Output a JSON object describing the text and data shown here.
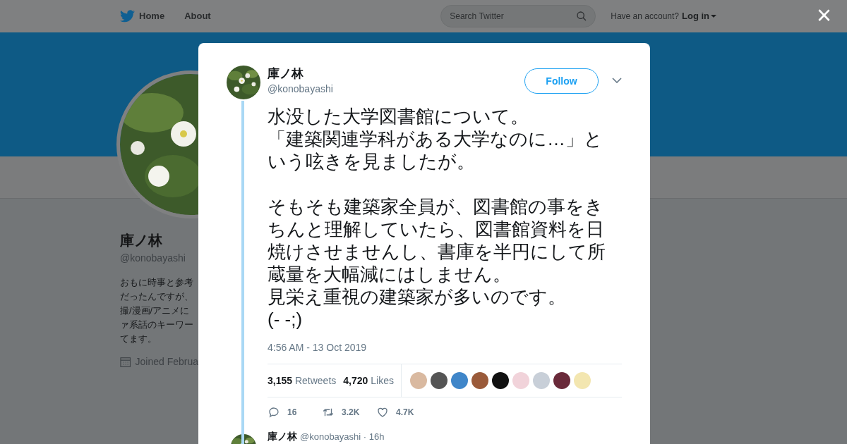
{
  "nav": {
    "items": [
      "Home",
      "About"
    ],
    "search": {
      "placeholder": "Search Twitter"
    },
    "account_prompt": "Have an account?",
    "login": "Log in",
    "close": "×"
  },
  "profile": {
    "name": "庫ノ林",
    "handle": "@konobayashi",
    "bio_lines": [
      "おもに時事と参考",
      "だったんですが、",
      "撮/漫画/アニメに",
      "ァ系話のキーワー",
      "てます。"
    ],
    "joined": "Joined Februa"
  },
  "tweet": {
    "name": "庫ノ林",
    "handle": "@konobayashi",
    "follow": "Follow",
    "paragraphs": [
      [
        "水没した大学図書館について。",
        "「建築関連学科がある大学なのに…」という呟きを見ましたが。"
      ],
      [
        "そもそも建築家全員が、図書館の事をきちんと理解していたら、図書館資料を日焼けさせませんし、書庫を半円にして所蔵量を大幅減にはしません。",
        "見栄え重視の建築家が多いのです。",
        "(- -;)"
      ]
    ],
    "time": "4:56 AM - 13 Oct 2019",
    "stats": [
      "**3,155** Retweets",
      "**4,720** Likes"
    ],
    "likers": [
      {
        "color": "#d9b9a0"
      },
      {
        "color": "#555555"
      },
      {
        "color": "#3f86c9"
      },
      {
        "color": "#9a5a3a"
      },
      {
        "color": "#111111"
      },
      {
        "color": "#f1d3da"
      },
      {
        "color": "#c8cfd8"
      },
      {
        "color": "#6a2a3a"
      },
      {
        "color": "#f3e6b0"
      }
    ],
    "actions": [
      {
        "kind": "reply",
        "count": "16"
      },
      {
        "kind": "retweet",
        "count": "3.2K"
      },
      {
        "kind": "like",
        "count": "4.7K"
      }
    ]
  },
  "next_tweet": {
    "name": "庫ノ林",
    "handle": "@konobayashi · 16h"
  }
}
